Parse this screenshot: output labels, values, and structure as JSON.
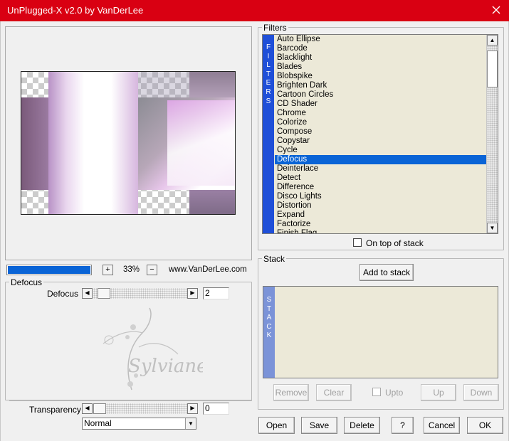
{
  "window": {
    "title": "UnPlugged-X v2.0 by VanDerLee"
  },
  "preview": {
    "zoom": "33%",
    "zoom_in": "+",
    "zoom_out": "−",
    "website": "www.VanDerLee.com",
    "progress": 1.0
  },
  "filters": {
    "label": "Filters",
    "strip": [
      "F",
      "I",
      "L",
      "T",
      "E",
      "R",
      "S"
    ],
    "items": [
      "Auto Ellipse",
      "Barcode",
      "Blacklight",
      "Blades",
      "Blobspike",
      "Brighten Dark",
      "Cartoon Circles",
      "CD Shader",
      "Chrome",
      "Colorize",
      "Compose",
      "Copystar",
      "Cycle",
      "Defocus",
      "Deinterlace",
      "Detect",
      "Difference",
      "Disco Lights",
      "Distortion",
      "Expand",
      "Factorize",
      "Finish Flag"
    ],
    "selected": "Defocus",
    "on_top_label": "On top of stack"
  },
  "params": {
    "group_label": "Defocus",
    "defocus_label": "Defocus",
    "defocus_value": "2",
    "defocus_level": 0.05,
    "transparency_label": "Transparency",
    "transparency_value": "0",
    "transparency_level": 0.0,
    "blend_mode": "Normal"
  },
  "watermark": {
    "text": "Sylviane"
  },
  "stack": {
    "label": "Stack",
    "strip": [
      "S",
      "T",
      "A",
      "C",
      "K"
    ],
    "add_label": "Add to stack",
    "remove_label": "Remove",
    "clear_label": "Clear",
    "upto_label": "Upto",
    "up_label": "Up",
    "down_label": "Down"
  },
  "buttons": {
    "open": "Open",
    "save": "Save",
    "delete": "Delete",
    "help": "?",
    "cancel": "Cancel",
    "ok": "OK"
  },
  "colors": {
    "title_bar": "#d90012",
    "selection": "#0a64d6",
    "filter_strip": "#1f4fd8",
    "stack_strip": "#7b93d8",
    "list_bg": "#ece9d8"
  }
}
